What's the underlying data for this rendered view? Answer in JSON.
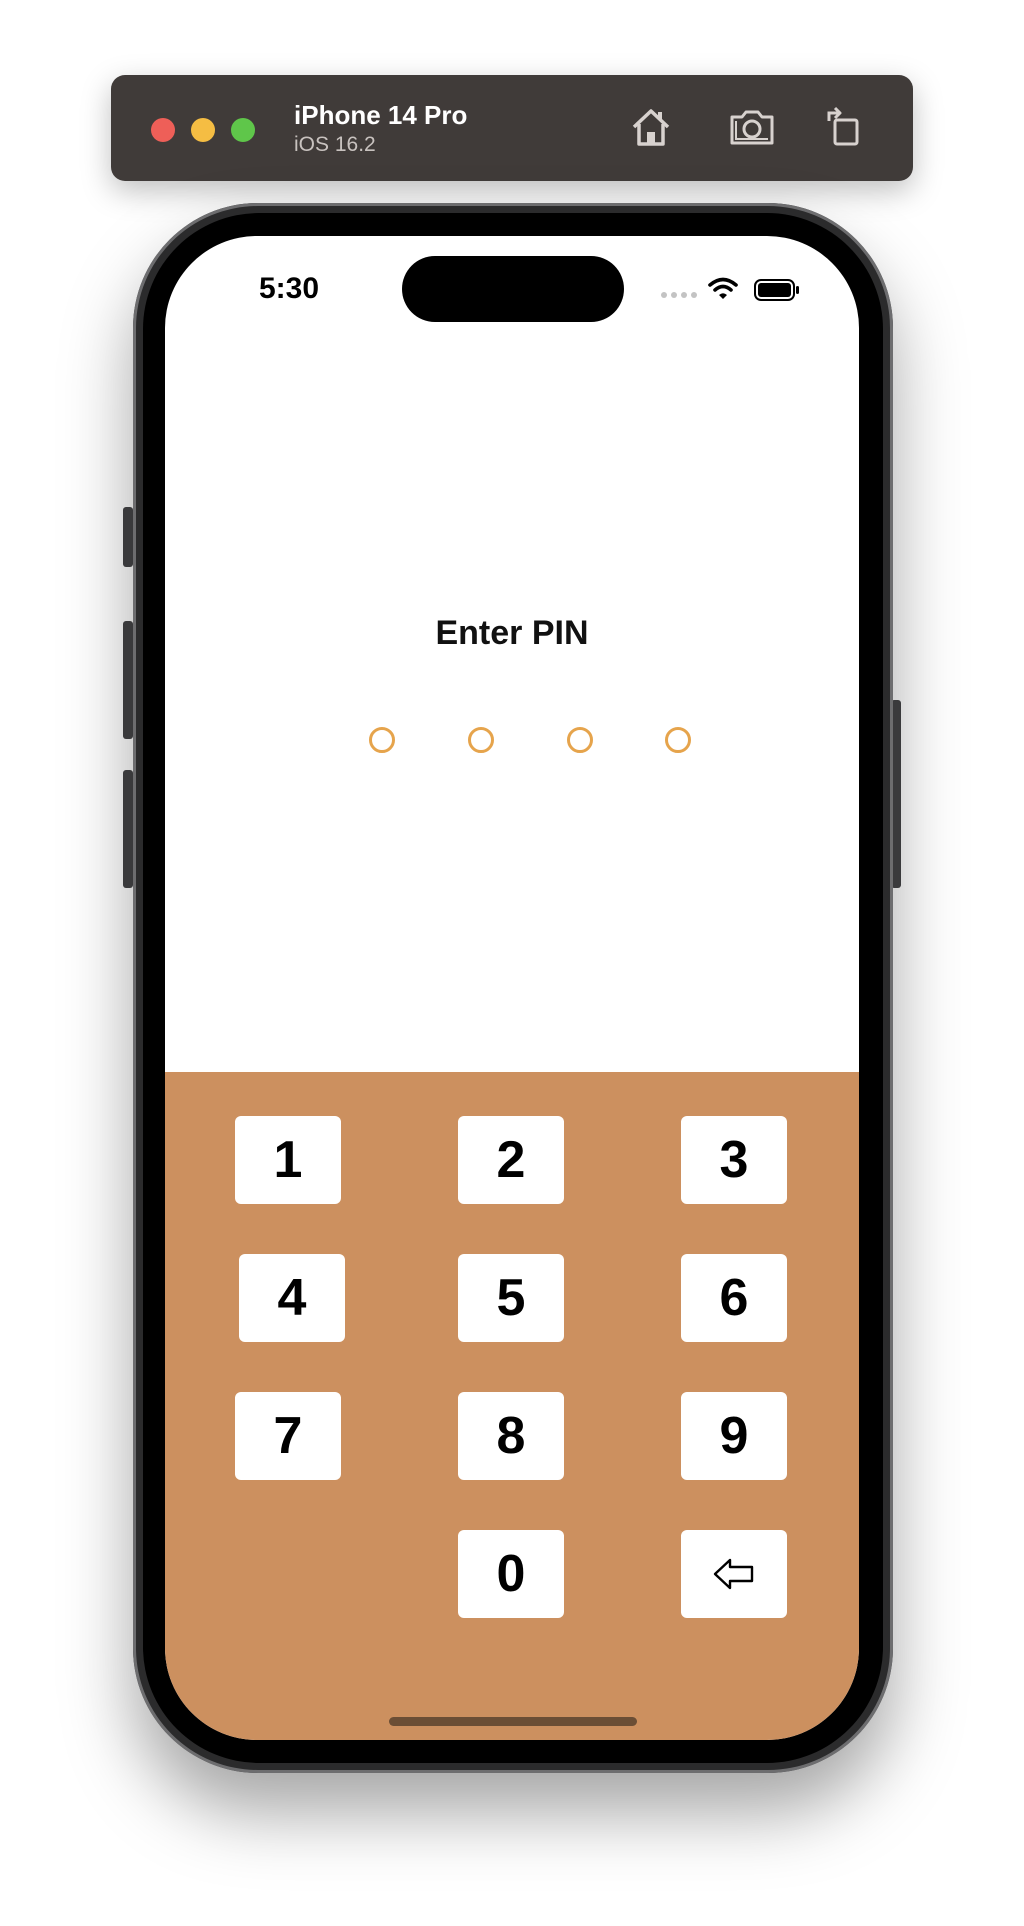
{
  "simulator": {
    "device_name": "iPhone 14 Pro",
    "os_version": "iOS 16.2",
    "toolbar_icons": [
      "home-icon",
      "screenshot-icon",
      "rotate-icon"
    ]
  },
  "status_bar": {
    "time": "5:30",
    "icons": [
      "cellular-icon",
      "wifi-icon",
      "battery-icon"
    ]
  },
  "pin_screen": {
    "title": "Enter PIN",
    "pin_length": 4,
    "entered_digits": 0,
    "dot_color": "#e6a44c"
  },
  "keypad": {
    "background_color": "#cc905f",
    "keys": [
      "1",
      "2",
      "3",
      "4",
      "5",
      "6",
      "7",
      "8",
      "9",
      "0"
    ],
    "backspace_icon": "backspace-arrow-icon"
  }
}
